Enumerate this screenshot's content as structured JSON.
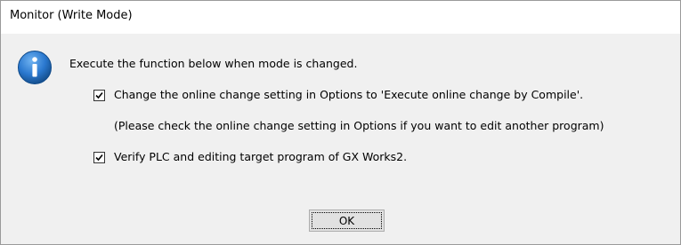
{
  "window": {
    "title": "Monitor (Write Mode)"
  },
  "dialog": {
    "icon": "info-icon",
    "message": "Execute the function below when mode is changed.",
    "options": [
      {
        "checked": true,
        "label": "Change the online change setting in Options to 'Execute online change by Compile'."
      },
      {
        "checked": true,
        "label": "Verify PLC and editing target program of GX Works2."
      }
    ],
    "note": "(Please check the online change setting in Options if you want to edit another program)"
  },
  "buttons": {
    "ok_label": "OK"
  },
  "colors": {
    "icon_blue": "#1f6fc5",
    "dialog_bg": "#f0f0f0",
    "title_bg": "#ffffff"
  }
}
